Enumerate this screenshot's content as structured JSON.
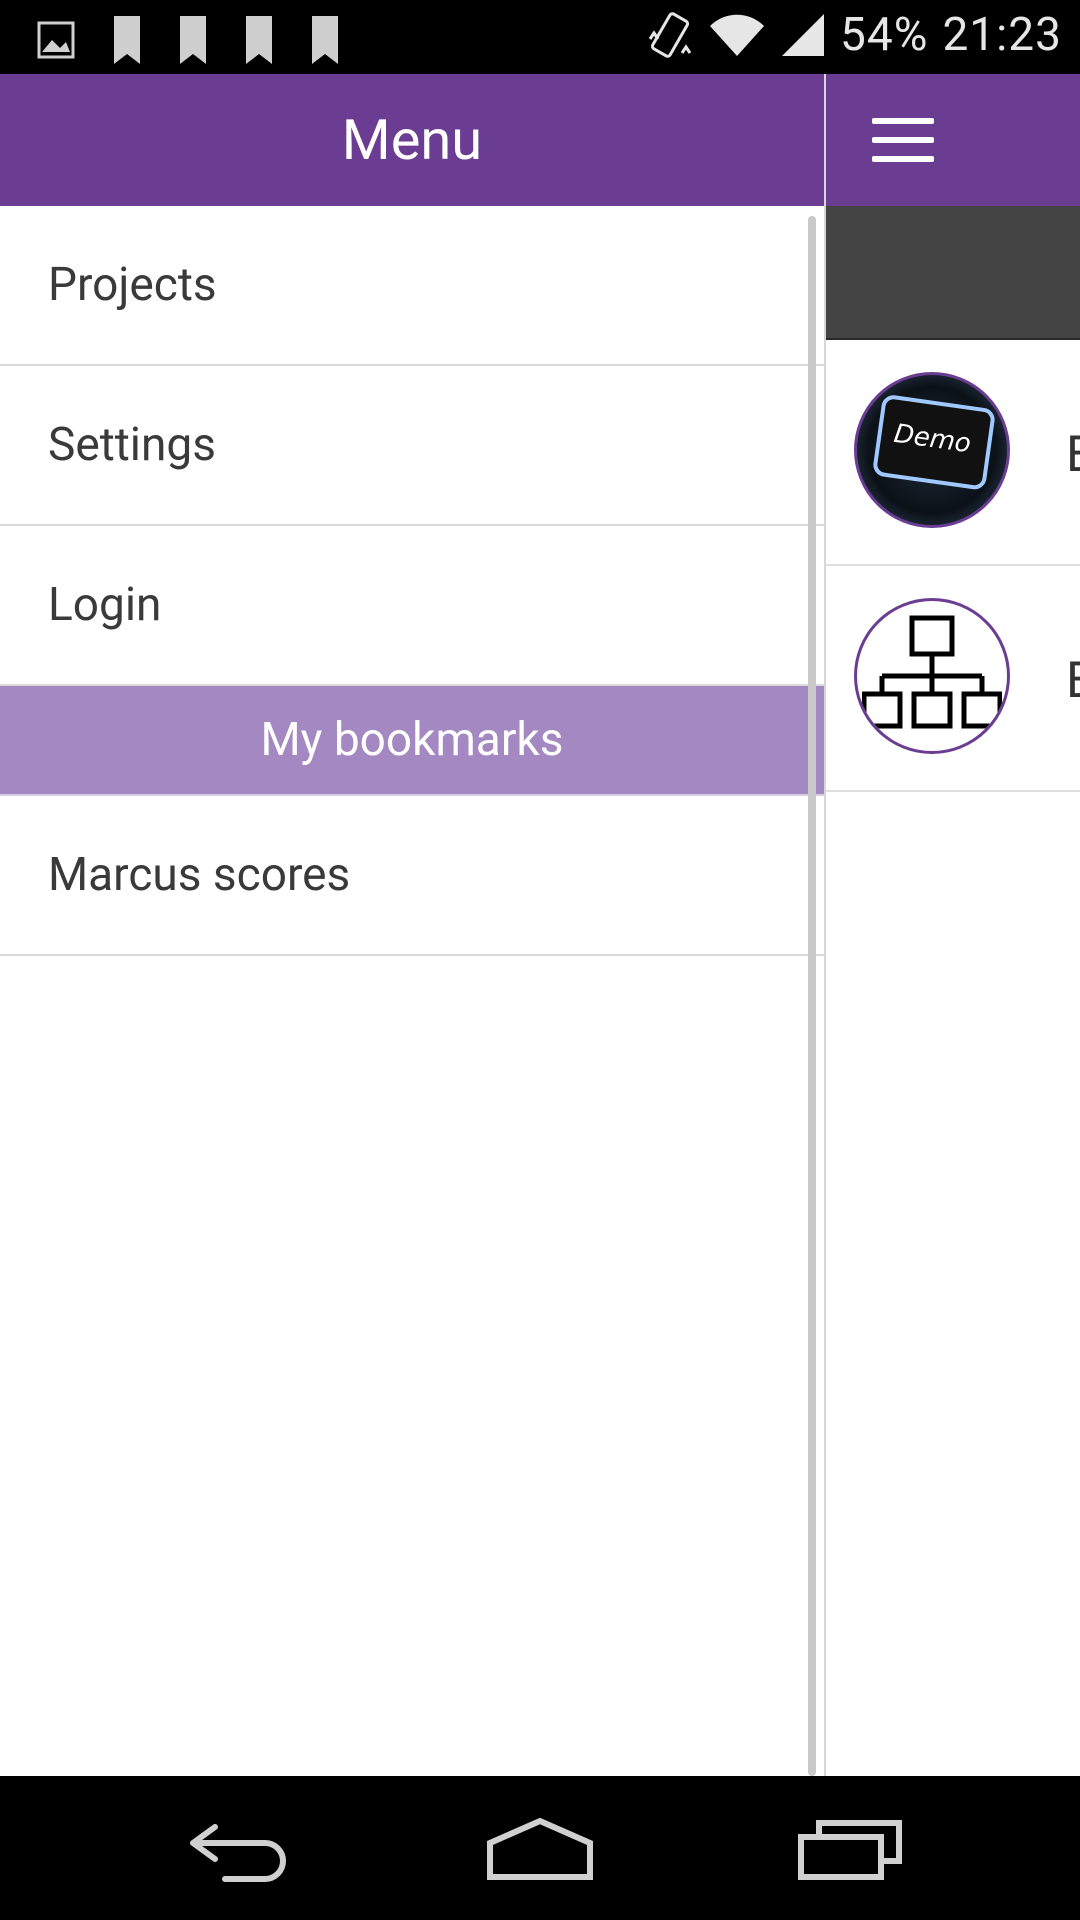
{
  "status": {
    "battery": "54%",
    "time": "21:23",
    "left_icons": [
      "image-icon",
      "bookmark-icon",
      "bookmark-icon",
      "bookmark-icon",
      "bookmark-icon"
    ],
    "right_icons": [
      "vibrate-icon",
      "wifi-icon",
      "signal-icon"
    ]
  },
  "drawer": {
    "title": "Menu",
    "items": [
      {
        "label": "Projects"
      },
      {
        "label": "Settings"
      },
      {
        "label": "Login"
      }
    ],
    "section_title": "My bookmarks",
    "bookmarks": [
      {
        "label": "Marcus scores"
      }
    ]
  },
  "main": {
    "list": [
      {
        "thumb_label": "Demo",
        "text": "E"
      },
      {
        "thumb_icon": "org-chart-icon",
        "text": "E"
      }
    ]
  },
  "colors": {
    "primary": "#6a3d92",
    "section": "#a488c1",
    "dark": "#444444"
  }
}
